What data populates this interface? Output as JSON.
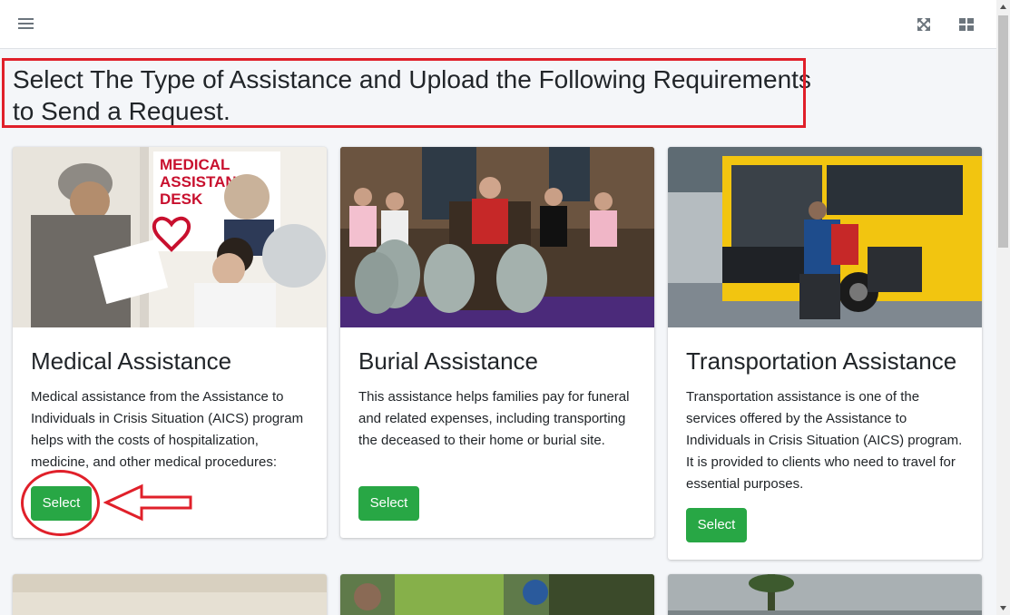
{
  "topbar": {
    "menu_icon": "hamburger-menu-icon",
    "fullscreen_icon": "expand-arrows-icon",
    "layout_icon": "grid-layout-icon"
  },
  "page": {
    "heading": "Select The Type of Assistance and Upload the Following Requirements to Send a Request."
  },
  "cards": [
    {
      "title": "Medical Assistance",
      "description": "Medical assistance from the Assistance to Individuals in Crisis Situation (AICS) program helps with the costs of hospitalization, medicine, and other medical procedures:",
      "button_label": "Select",
      "image_caption": "MEDICAL ASSISTANCE DESK"
    },
    {
      "title": "Burial Assistance",
      "description": "This assistance helps families pay for funeral and related expenses, including transporting the deceased to their home or burial site.",
      "button_label": "Select"
    },
    {
      "title": "Transportation Assistance",
      "description": "Transportation assistance is one of the services offered by the Assistance to Individuals in Crisis Situation (AICS) program. It is provided to clients who need to travel for essential purposes.",
      "button_label": "Select"
    }
  ],
  "annotations": {
    "color": "#e0202a"
  },
  "colors": {
    "select_button": "#28a745",
    "background": "#f4f6f9"
  }
}
